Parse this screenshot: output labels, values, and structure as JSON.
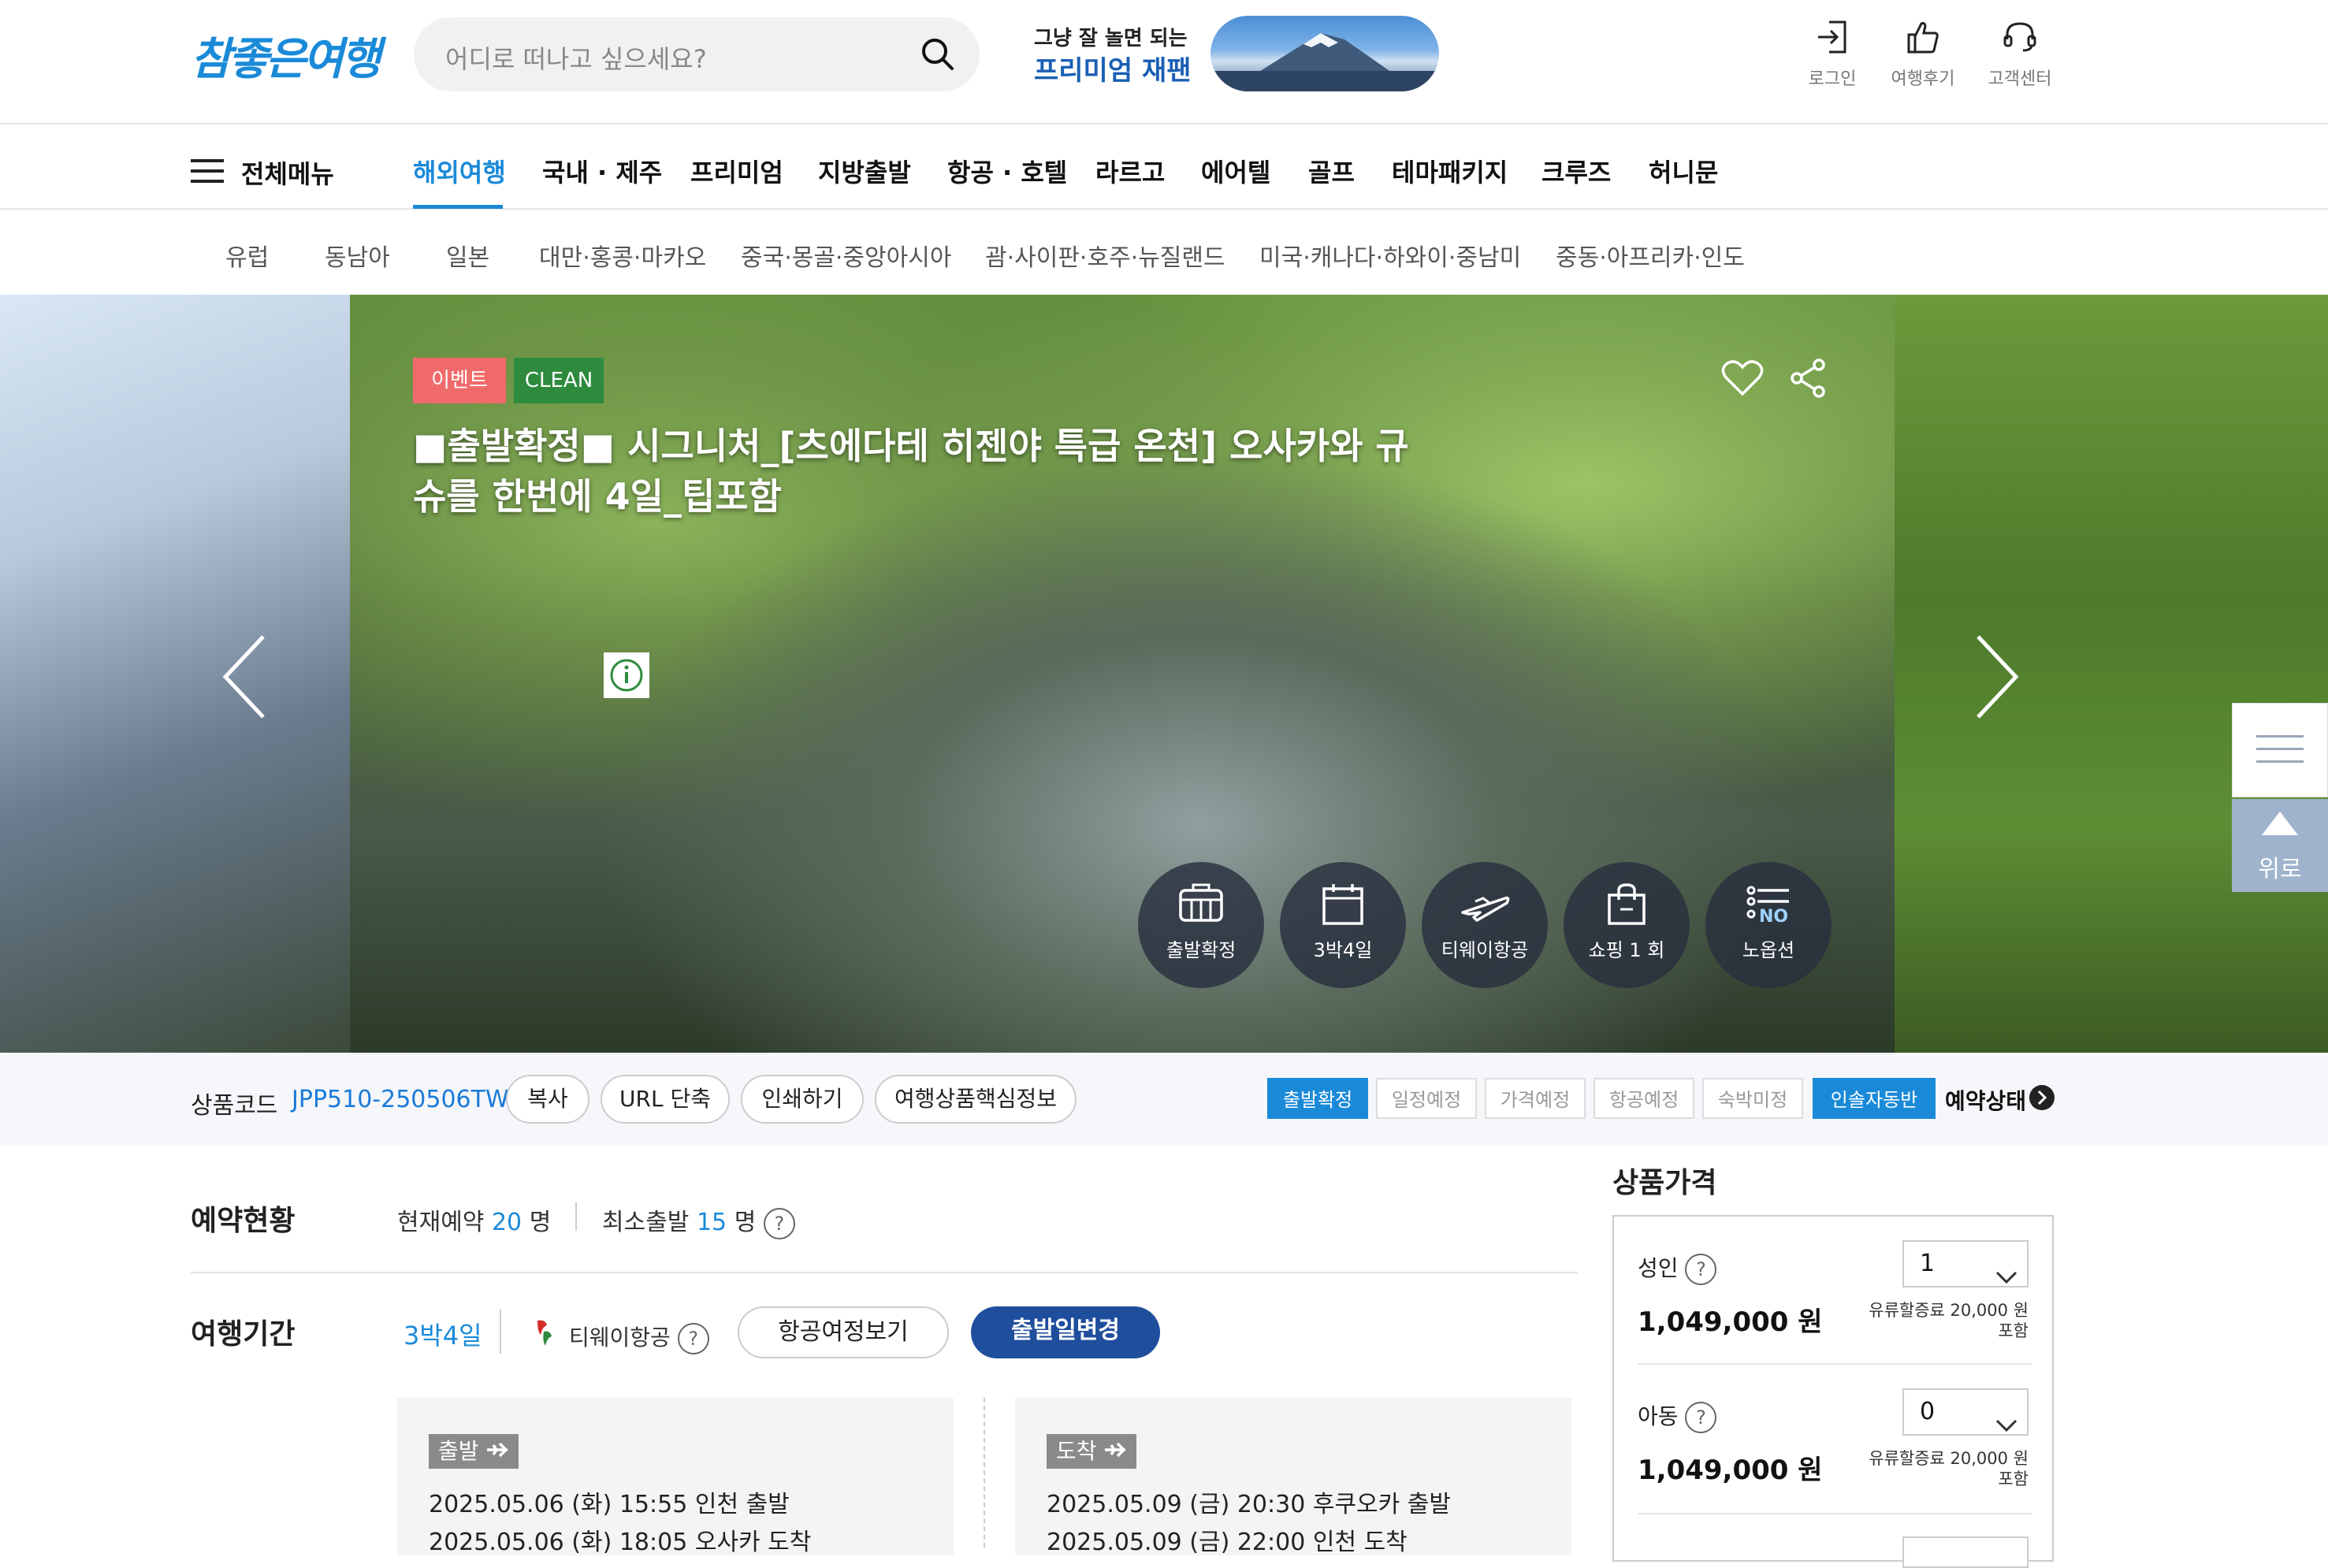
{
  "header": {
    "logo": "참좋은여행",
    "search_placeholder": "어디로 떠나고 싶으세요?",
    "promo_small": "그냥 잘 놀면 되는",
    "promo_big": "프리미엄 재팬",
    "utils": [
      {
        "label": "로그인",
        "icon": "login-icon"
      },
      {
        "label": "여행후기",
        "icon": "thumbs-up-icon"
      },
      {
        "label": "고객센터",
        "icon": "headset-icon"
      }
    ]
  },
  "gnb": {
    "all_menu": "전체메뉴",
    "items": [
      "해외여행",
      "국내 · 제주",
      "프리미엄",
      "지방출발",
      "항공 · 호텔",
      "라르고",
      "에어텔",
      "골프",
      "테마패키지",
      "크루즈",
      "허니문"
    ],
    "active": "해외여행"
  },
  "subnav": {
    "items": [
      "유럽",
      "동남아",
      "일본",
      "대만·홍콩·마카오",
      "중국·몽골·중앙아시아",
      "괌·사이판·호주·뉴질랜드",
      "미국·캐나다·하와이·중남미",
      "중동·아프리카·인도"
    ]
  },
  "hero": {
    "badge_event": "이벤트",
    "badge_clean": "CLEAN",
    "title": "■출발확정■ 시그니처_[츠에다테 히젠야 특급 온천] 오사카와 규슈를 한번에 4일_팁포함",
    "features": [
      {
        "label": "출발확정",
        "icon": "bus-icon"
      },
      {
        "label": "3박4일",
        "icon": "calendar-icon"
      },
      {
        "label": "티웨이항공",
        "icon": "airplane-icon"
      },
      {
        "label": "쇼핑 1 회",
        "icon": "shopping-bag-icon"
      },
      {
        "label": "노옵션",
        "icon": "no-option-icon"
      }
    ],
    "top_label": "위로"
  },
  "codebar": {
    "label": "상품코드",
    "code": "JPP510-250506TW",
    "buttons": [
      "복사",
      "URL 단축",
      "인쇄하기",
      "여행상품핵심정보"
    ],
    "status": [
      {
        "label": "출발확정",
        "on": true
      },
      {
        "label": "일정예정",
        "on": false
      },
      {
        "label": "가격예정",
        "on": false
      },
      {
        "label": "항공예정",
        "on": false
      },
      {
        "label": "숙박미정",
        "on": false
      },
      {
        "label": "인솔자동반",
        "on": true
      }
    ],
    "status_link": "예약상태"
  },
  "booking": {
    "title": "예약현황",
    "current_label": "현재예약",
    "current_count": "20",
    "min_label": "최소출발",
    "min_count": "15",
    "unit": "명"
  },
  "trip": {
    "title": "여행기간",
    "duration": "3박4일",
    "airline": "티웨이항공",
    "flight_button": "항공여정보기",
    "change_button": "출발일변경",
    "departure": {
      "tag": "출발",
      "line1": "2025.05.06 (화) 15:55 인천 출발",
      "line2": "2025.05.06 (화) 18:05 오사카 도착"
    },
    "arrival": {
      "tag": "도착",
      "line1": "2025.05.09 (금) 20:30 후쿠오카 출발",
      "line2": "2025.05.09 (금) 22:00 인천 도착"
    }
  },
  "price": {
    "title": "상품가격",
    "rows": [
      {
        "label": "성인",
        "amount": "1,049,000 원",
        "qty": "1",
        "note1": "유류할증료 20,000 원",
        "note2": "포함"
      },
      {
        "label": "아동",
        "amount": "1,049,000 원",
        "qty": "0",
        "note1": "유류할증료 20,000 원",
        "note2": "포함"
      }
    ]
  },
  "colors": {
    "brand": "#1a8ad8",
    "navy": "#1f4e9c",
    "event": "#f06a6a",
    "clean": "#2e8b3e"
  }
}
